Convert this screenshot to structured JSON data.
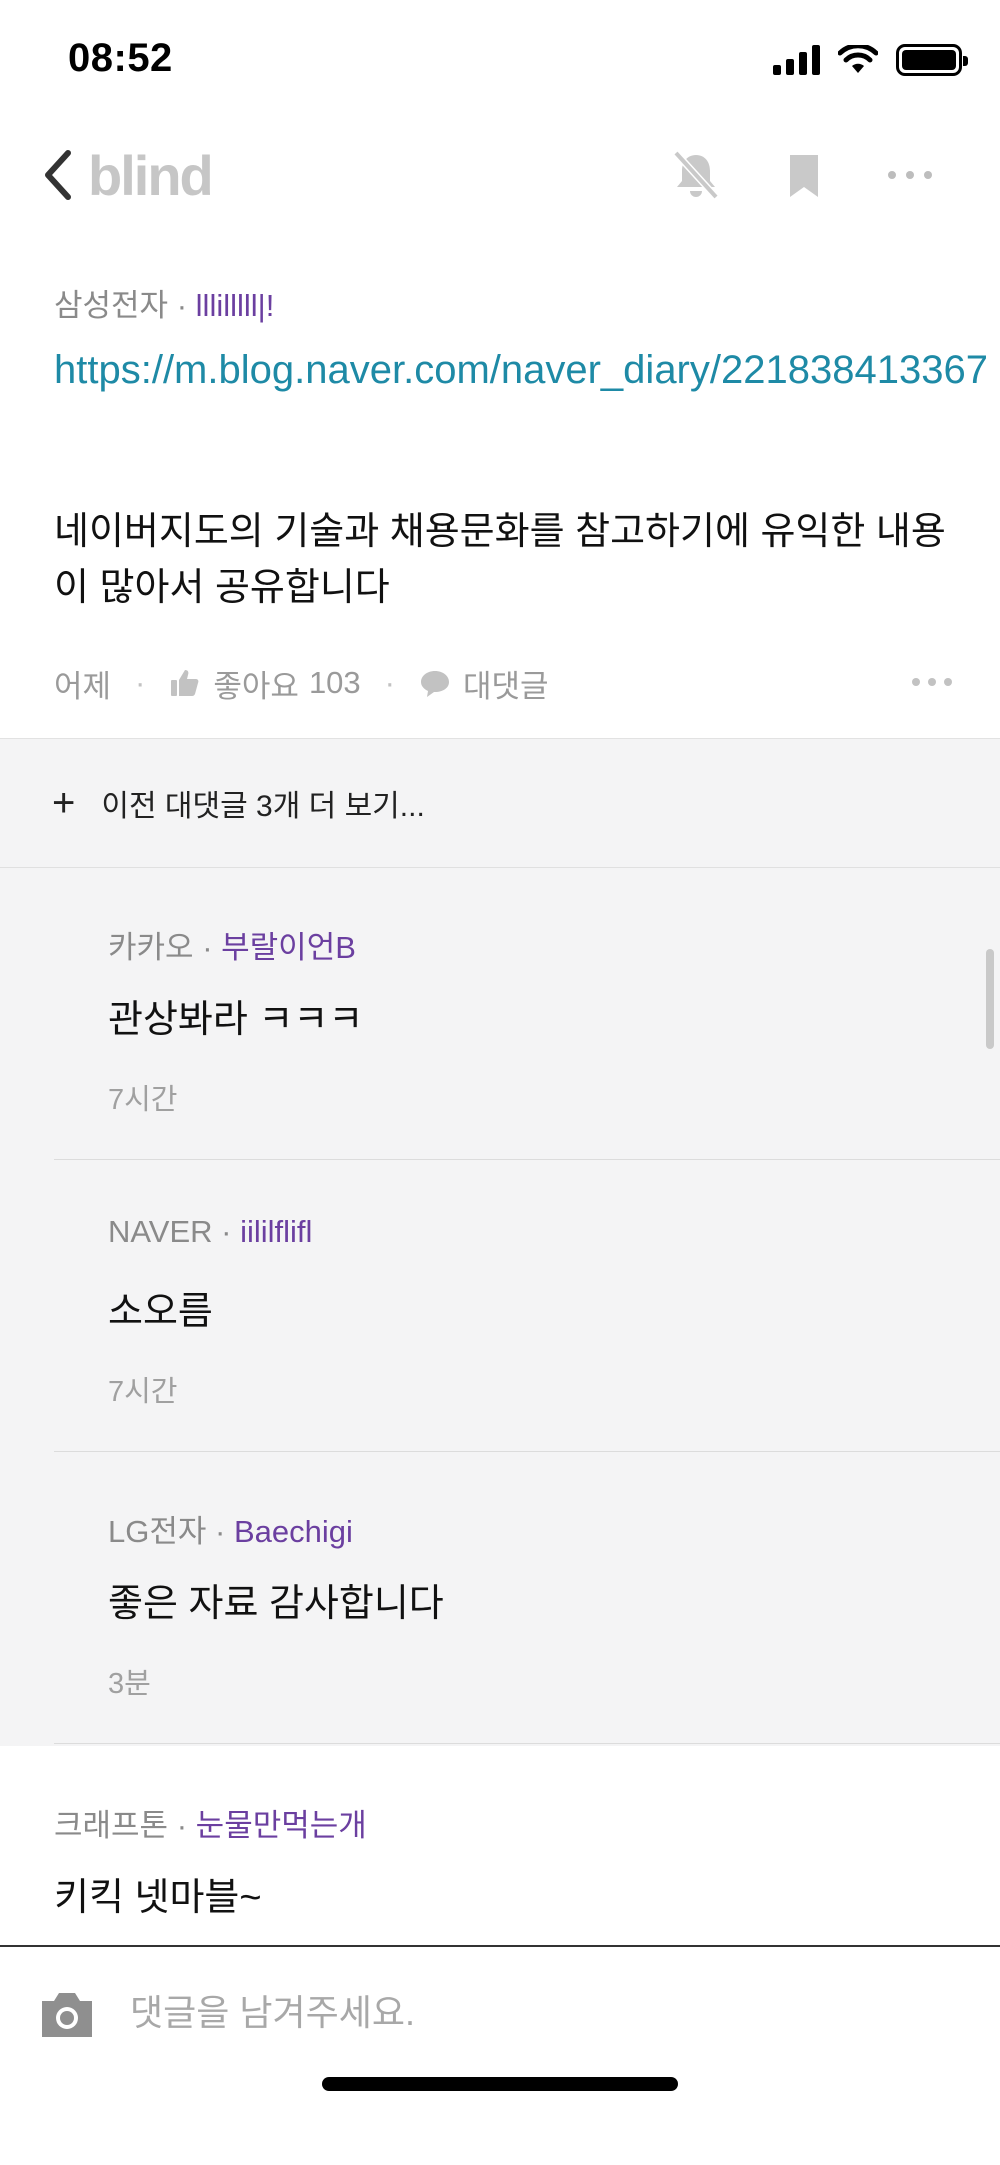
{
  "status_bar": {
    "time": "08:52"
  },
  "nav": {
    "brand": "blind"
  },
  "post": {
    "company": "삼성전자",
    "separator": "·",
    "nickname": "lllilllll|!",
    "link": "https://m.blog.naver.com/naver_diary/221838413367",
    "body": "네이버지도의 기술과 채용문화를 참고하기에 유익한 내용이 많아서 공유합니다",
    "time": "어제",
    "like_label": "좋아요",
    "like_count": "103",
    "reply_label": "대댓글"
  },
  "more_replies": {
    "label": "이전 대댓글 3개 더 보기..."
  },
  "replies": [
    {
      "company": "카카오",
      "nickname": "부랄이언B",
      "text": "관상봐라 ㅋㅋㅋ",
      "time": "7시간"
    },
    {
      "company": "NAVER",
      "nickname": "iililflifl",
      "text": "소오름",
      "time": "7시간"
    },
    {
      "company": "LG전자",
      "nickname": "Baechigi",
      "text": "좋은 자료 감사합니다",
      "time": "3분"
    }
  ],
  "comment": {
    "company": "크래프톤",
    "nickname": "눈물만먹는개",
    "text": "키킥 넷마블~"
  },
  "input": {
    "placeholder": "댓글을 남겨주세요."
  },
  "colors": {
    "link": "#1e8aa6",
    "nickname": "#6b3fa0",
    "brand": "#c6c6c6"
  }
}
